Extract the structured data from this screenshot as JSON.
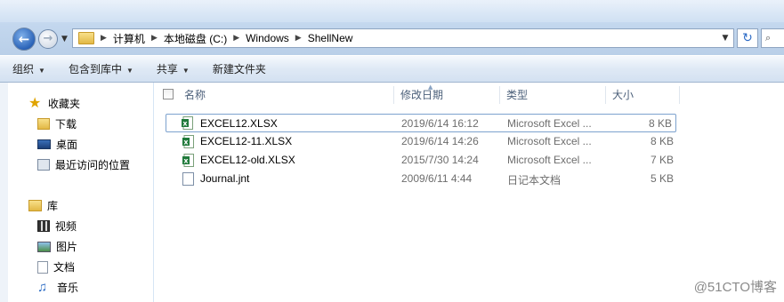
{
  "address": {
    "crumbs": [
      "计算机",
      "本地磁盘 (C:)",
      "Windows",
      "ShellNew"
    ]
  },
  "toolbar": {
    "organize": "组织",
    "include_in_library": "包含到库中",
    "share": "共享",
    "new_folder": "新建文件夹"
  },
  "sidebar": {
    "favorites": {
      "label": "收藏夹",
      "items": [
        "下载",
        "桌面",
        "最近访问的位置"
      ]
    },
    "libraries": {
      "label": "库",
      "items": [
        "视频",
        "图片",
        "文档",
        "音乐"
      ]
    }
  },
  "columns": {
    "name": "名称",
    "modified": "修改日期",
    "type": "类型",
    "size": "大小"
  },
  "files": [
    {
      "name": "EXCEL12.XLSX",
      "modified": "2019/6/14 16:12",
      "type": "Microsoft Excel ...",
      "size": "8 KB",
      "icon": "excel-icon"
    },
    {
      "name": "EXCEL12-11.XLSX",
      "modified": "2019/6/14 14:26",
      "type": "Microsoft Excel ...",
      "size": "8 KB",
      "icon": "excel-icon"
    },
    {
      "name": "EXCEL12-old.XLSX",
      "modified": "2015/7/30 14:24",
      "type": "Microsoft Excel ...",
      "size": "7 KB",
      "icon": "excel-icon"
    },
    {
      "name": "Journal.jnt",
      "modified": "2009/6/11 4:44",
      "type": "日记本文档",
      "size": "5 KB",
      "icon": "journal-icon"
    }
  ],
  "watermark": "@51CTO博客",
  "colors": {
    "accent": "#2a63b8",
    "selection_border": "#7da2ce",
    "toolbar": "#dfe9f5"
  }
}
